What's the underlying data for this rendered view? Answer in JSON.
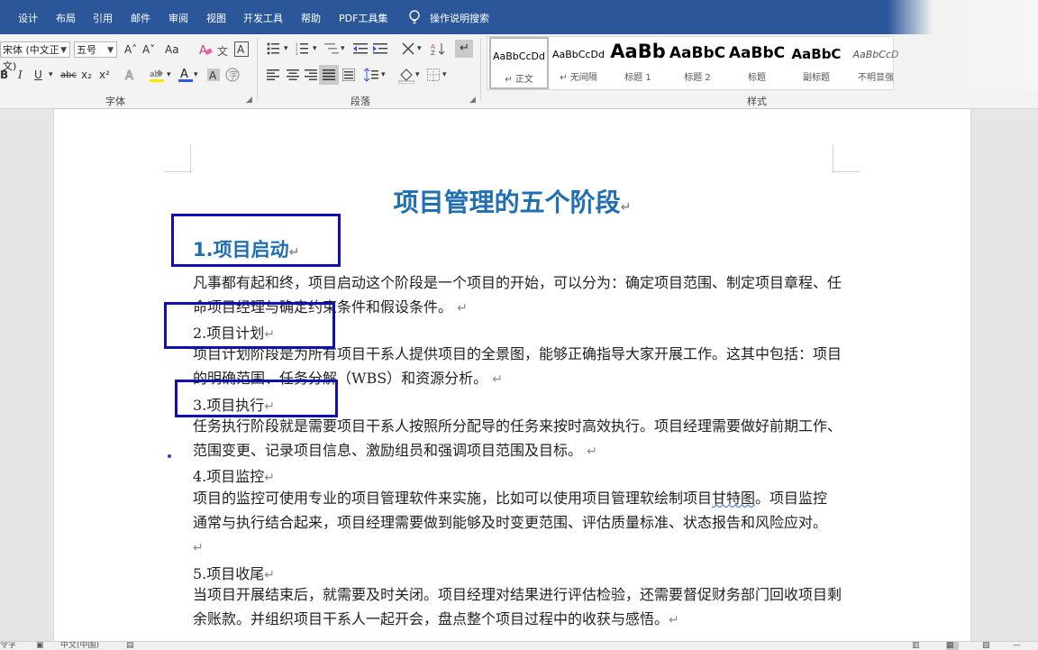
{
  "menu": {
    "tabs": [
      "设计",
      "布局",
      "引用",
      "邮件",
      "审阅",
      "视图",
      "开发工具",
      "帮助",
      "PDF工具集"
    ],
    "search_label": "操作说明搜索"
  },
  "ribbon": {
    "font": {
      "font_name": "宋体 (中文正文)",
      "font_size": "五号",
      "group_label": "字体",
      "buttons": {
        "grow": "A˄",
        "shrink": "A˅",
        "change_case": "Aa",
        "bold": "B",
        "italic": "I",
        "underline": "U",
        "strike": "abc",
        "subscript": "x₂",
        "superscript": "x²",
        "font_color": "A"
      }
    },
    "paragraph": {
      "group_label": "段落"
    },
    "styles": {
      "group_label": "样式",
      "items": [
        {
          "sample": "AaBbCcDd",
          "name": "↵ 正文"
        },
        {
          "sample": "AaBbCcDd",
          "name": "↵ 无间隔"
        },
        {
          "sample": "AaBb",
          "name": "标题 1"
        },
        {
          "sample": "AaBbC",
          "name": "标题 2"
        },
        {
          "sample": "AaBbC",
          "name": "标题"
        },
        {
          "sample": "AaBbC",
          "name": "副标题"
        },
        {
          "sample": "AaBbCcD",
          "name": "不明显强"
        }
      ]
    }
  },
  "document": {
    "title": "项目管理的五个阶段",
    "sections": [
      {
        "heading": "1.项目启动",
        "body": "凡事都有起和终，项目启动这个阶段是一个项目的开始，可以分为：确定项目范围、制定项目章程、任命项目经理与确定约束条件和假设条件。"
      },
      {
        "heading": "2.项目计划",
        "body": "项目计划阶段是为所有项目干系人提供项目的全景图，能够正确指导大家开展工作。这其中包括：项目的明确范围、任务分解（WBS）和资源分析。"
      },
      {
        "heading": "3.项目执行",
        "body": "任务执行阶段就是需要项目干系人按照所分配导的任务来按时高效执行。项目经理需要做好前期工作、范围变更、记录项目信息、激励组员和强调项目范围及目标。"
      },
      {
        "heading": "4.项目监控",
        "body_pre": "项目的监控可使用专业的项目管理软件来实施，比如可以使用项目管理软绘制项目",
        "body_typo": "甘特图",
        "body_post": "。项目监控通常与执行结合起来，项目经理需要做到能够及时变更范围、评估质量标准、状态报告和风险应对。"
      },
      {
        "heading": "5.项目收尾",
        "body": "当项目开展结束后，就需要及时关闭。项目经理对结果进行评估检验，还需要督促财务部门回收项目剩余账款。并组织项目干系人一起开会，盘点整个项目过程中的收获与感悟。"
      }
    ],
    "para_mark": "↵"
  },
  "statusbar": {
    "left": "令字",
    "lang": "中文(中国)"
  }
}
